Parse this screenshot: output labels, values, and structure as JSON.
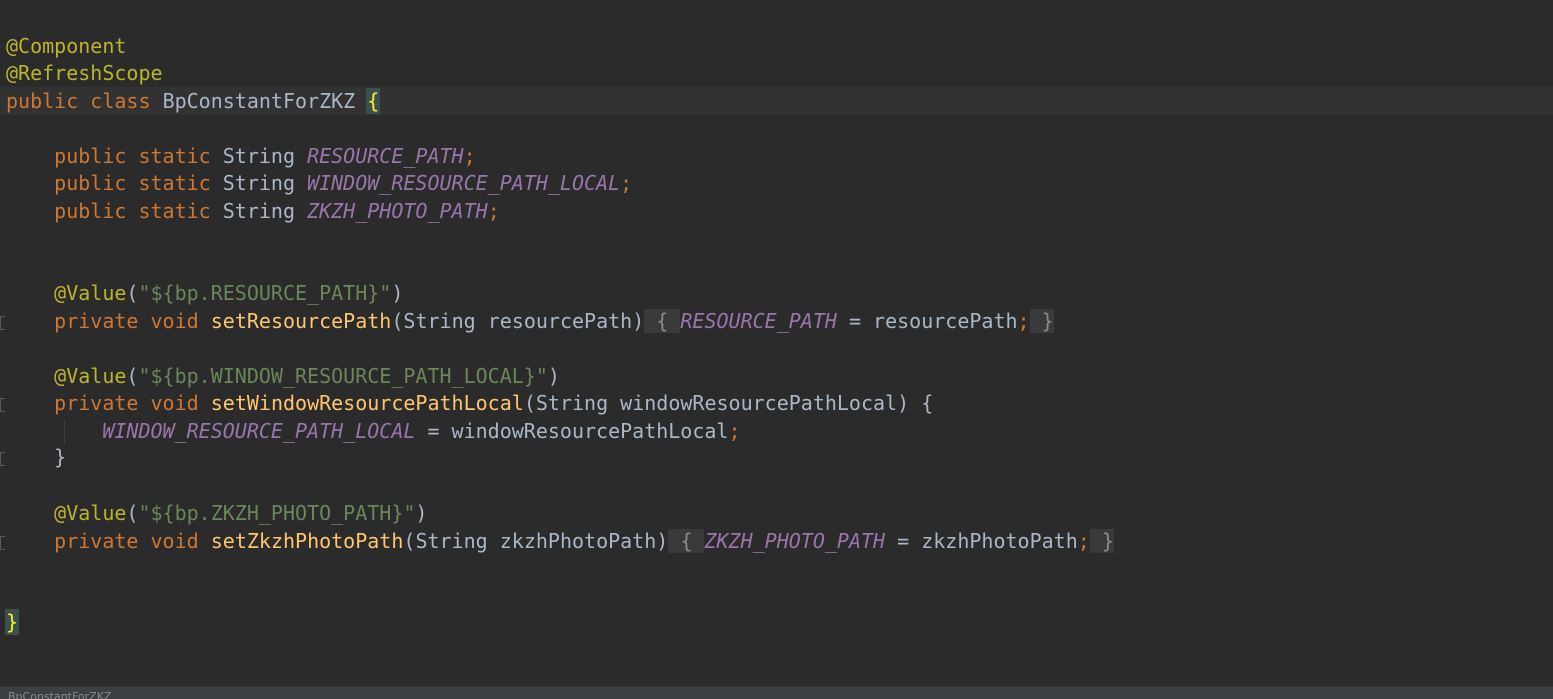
{
  "editor": {
    "annotations": {
      "component": "@Component",
      "refresh_scope": "@RefreshScope",
      "value": "@Value"
    },
    "class_decl": {
      "kw_public": "public",
      "kw_class": "class",
      "name": "BpConstantForZKZ",
      "open_brace": "{",
      "close_brace": "}"
    },
    "fields": [
      {
        "kw_public": "public",
        "kw_static": "static",
        "type": "String",
        "name": "RESOURCE_PATH",
        "semi": ";"
      },
      {
        "kw_public": "public",
        "kw_static": "static",
        "type": "String",
        "name": "WINDOW_RESOURCE_PATH_LOCAL",
        "semi": ";"
      },
      {
        "kw_public": "public",
        "kw_static": "static",
        "type": "String",
        "name": "ZKZH_PHOTO_PATH",
        "semi": ";"
      }
    ],
    "methods": [
      {
        "value_open": "(",
        "value_str": "\"${bp.RESOURCE_PATH}\"",
        "value_close": ")",
        "kw_private": "private",
        "kw_void": "void",
        "name": "setResourcePath",
        "param_open": "(",
        "param_type": "String",
        "param_name": "resourcePath",
        "param_close": ")",
        "fold_open": " { ",
        "field": "RESOURCE_PATH",
        "assign": " = ",
        "rhs": "resourcePath",
        "semi": ";",
        "fold_close": " }"
      },
      {
        "value_open": "(",
        "value_str": "\"${bp.WINDOW_RESOURCE_PATH_LOCAL}\"",
        "value_close": ")",
        "kw_private": "private",
        "kw_void": "void",
        "name": "setWindowResourcePathLocal",
        "param_open": "(",
        "param_type": "String",
        "param_name": "windowResourcePathLocal",
        "param_close": ") {",
        "field": "WINDOW_RESOURCE_PATH_LOCAL",
        "assign": " = ",
        "rhs": "windowResourcePathLocal",
        "semi": ";",
        "body_close": "}"
      },
      {
        "value_open": "(",
        "value_str": "\"${bp.ZKZH_PHOTO_PATH}\"",
        "value_close": ")",
        "kw_private": "private",
        "kw_void": "void",
        "name": "setZkzhPhotoPath",
        "param_open": "(",
        "param_type": "String",
        "param_name": "zkzhPhotoPath",
        "param_close": ")",
        "fold_open": " { ",
        "field": "ZKZH_PHOTO_PATH",
        "assign": " = ",
        "rhs": "zkzhPhotoPath",
        "semi": ";",
        "fold_close": " }"
      }
    ]
  },
  "statusbar": {
    "breadcrumb": "BpConstantForZKZ"
  },
  "colors": {
    "background": "#2b2b2b",
    "annotation": "#bbb529",
    "keyword": "#cc7832",
    "static_field": "#9876aa",
    "string": "#6a8759",
    "method": "#ffc66d",
    "text": "#a9b7c6"
  }
}
